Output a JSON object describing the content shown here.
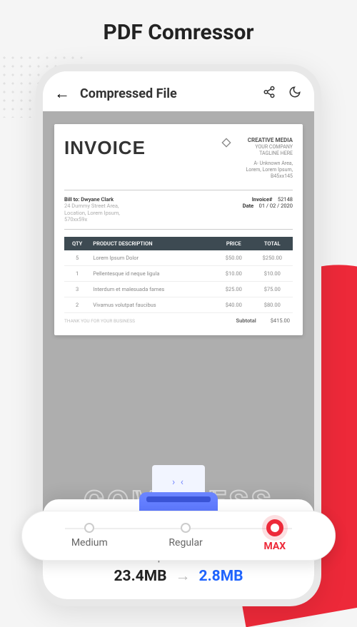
{
  "page_title": "PDF Comressor",
  "topbar": {
    "title": "Compressed File"
  },
  "document": {
    "heading": "INVOICE",
    "brand_name": "CREATIVE MEDIA",
    "brand_tagline": "YOUR COMPANY TAGLINE HERE",
    "brand_addr1": "A- Unknown Area,",
    "brand_addr2": "Lorem, Lorem Ipsum,",
    "brand_addr3": "B45xx145",
    "bill_label": "Bill to:",
    "bill_name": "Dwyane Clark",
    "bill_addr1": "24 Dummy Street Area,",
    "bill_addr2": "Location, Lorem Ipsum,",
    "bill_addr3": "570xx59x",
    "inv_no_label": "Invoice#",
    "inv_no": "52148",
    "date_label": "Date",
    "date": "01 / 02 / 2020",
    "cols": {
      "qty": "QTY",
      "desc": "PRODUCT DESCRIPTION",
      "price": "PRICE",
      "total": "TOTAL"
    },
    "rows": [
      {
        "qty": "5",
        "desc": "Lorem Ipsum Dolor",
        "price": "$50.00",
        "total": "$250.00"
      },
      {
        "qty": "1",
        "desc": "Pellentesque id neque ligula",
        "price": "$10.00",
        "total": "$10.00"
      },
      {
        "qty": "3",
        "desc": "Interdum et malesuada fames",
        "price": "$25.00",
        "total": "$75.00"
      },
      {
        "qty": "2",
        "desc": "Vivamus volutpat faucibus",
        "price": "$40.00",
        "total": "$80.00"
      }
    ],
    "thank": "THANK YOU FOR YOUR BUSINESS",
    "subtotal_label": "Subtotal",
    "subtotal": "$415.00"
  },
  "bg_word": "COMPRESS",
  "sheet": {
    "label": "Compressed size",
    "before": "23.4MB",
    "after": "2.8MB"
  },
  "levels": [
    {
      "label": "Medium",
      "active": false
    },
    {
      "label": "Regular",
      "active": false
    },
    {
      "label": "MAX",
      "active": true
    }
  ]
}
